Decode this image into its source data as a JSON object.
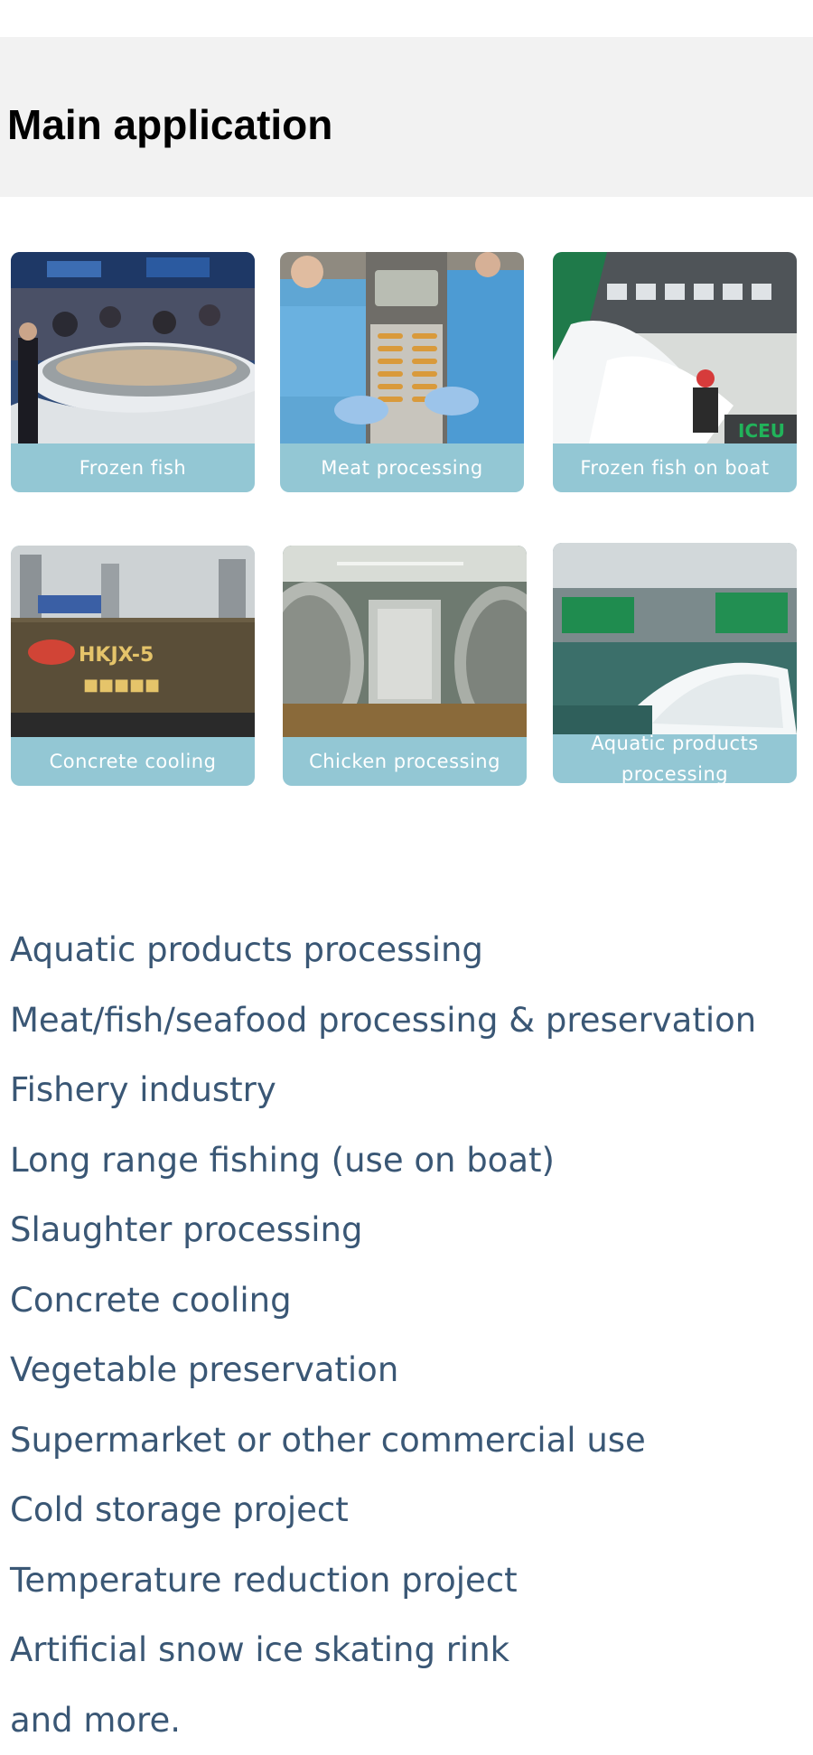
{
  "header": {
    "title": "Main application"
  },
  "colors": {
    "header_band": "#f2f2f2",
    "card_label_bg": "#93c7d4",
    "list_text": "#3a5775"
  },
  "cards": [
    {
      "label": "Frozen fish",
      "image": "fish-market-counter-photo"
    },
    {
      "label": "Meat processing",
      "image": "meat-processing-line-photo"
    },
    {
      "label": "Frozen fish on boat",
      "image": "fishing-boat-ice-photo"
    },
    {
      "label": "Concrete cooling",
      "image": "construction-site-sign-photo"
    },
    {
      "label": "Chicken processing",
      "image": "cold-room-tunnel-photo"
    },
    {
      "label": "Aquatic products processing",
      "image": "ice-pile-factory-photo"
    }
  ],
  "applications": [
    "Aquatic products processing",
    "Meat/fish/seafood processing & preservation",
    "Fishery industry",
    "Long range fishing (use on boat)",
    "Slaughter processing",
    "Concrete cooling",
    "Vegetable preservation",
    "Supermarket or other commercial use",
    "Cold storage project",
    "Temperature reduction project",
    "Artificial snow ice skating rink",
    "and more."
  ]
}
